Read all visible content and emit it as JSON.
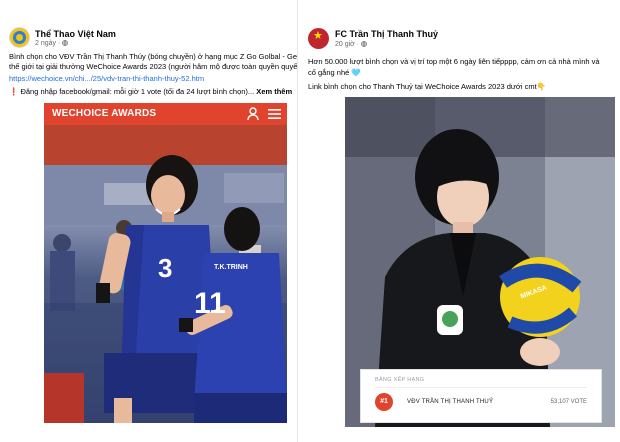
{
  "left_post": {
    "page_name": "Thể Thao Việt Nam",
    "time": "2 ngày",
    "audience_icon": "globe-icon",
    "text_lines": [
      "Bình chọn cho VĐV Trần Thị Thanh Thúy (bóng chuyền) ở hạng mục Z Go Golbal - GenZ vư",
      "thế giới tại giải thưởng WeChoice Awards 2023 (người hâm mộ được toàn quyền quyết địn"
    ],
    "link": "https://wechoice.vn/chi.../25/vdv-tran-thi-thanh-thuy-52.htm",
    "note_prefix": "❗",
    "note": "Đăng nhập facebook/gmail: mỗi giờ 1 vote (tối đa 24 lượt bình chọn)...",
    "see_more": "Xem thêm",
    "image": {
      "brand": "WECHOICE AWARDS",
      "icons": [
        "user-icon",
        "menu-icon"
      ],
      "jersey_front": "3",
      "jersey_back": "11",
      "jersey_back_name": "T.K.TRINH"
    }
  },
  "right_post": {
    "page_name": "FC Trần Thị Thanh Thuỷ",
    "time": "20 giờ",
    "audience_icon": "globe-icon",
    "text_lines": [
      "Hơn 50.000 lượt bình chọn và vị trí top một 6 ngày liên tiếpppp, cảm ơn cả nhà mình và",
      "cố gắng nhé 🩵"
    ],
    "text_line3": "Link bình chọn cho Thanh Thuỷ tại WeChoice Awards 2023 dưới cmt👇",
    "image": {
      "ball_brand": "MIKASA",
      "ranking": {
        "title": "BẢNG XẾP HẠNG",
        "rank": "#1",
        "name": "VĐV TRẦN THỊ THANH THUỶ",
        "votes": "53,107 VOTE"
      }
    }
  },
  "colors": {
    "wechoice_red": "#e0442e",
    "link_blue": "#216fdb",
    "jersey_blue": "#2b3fa8"
  }
}
